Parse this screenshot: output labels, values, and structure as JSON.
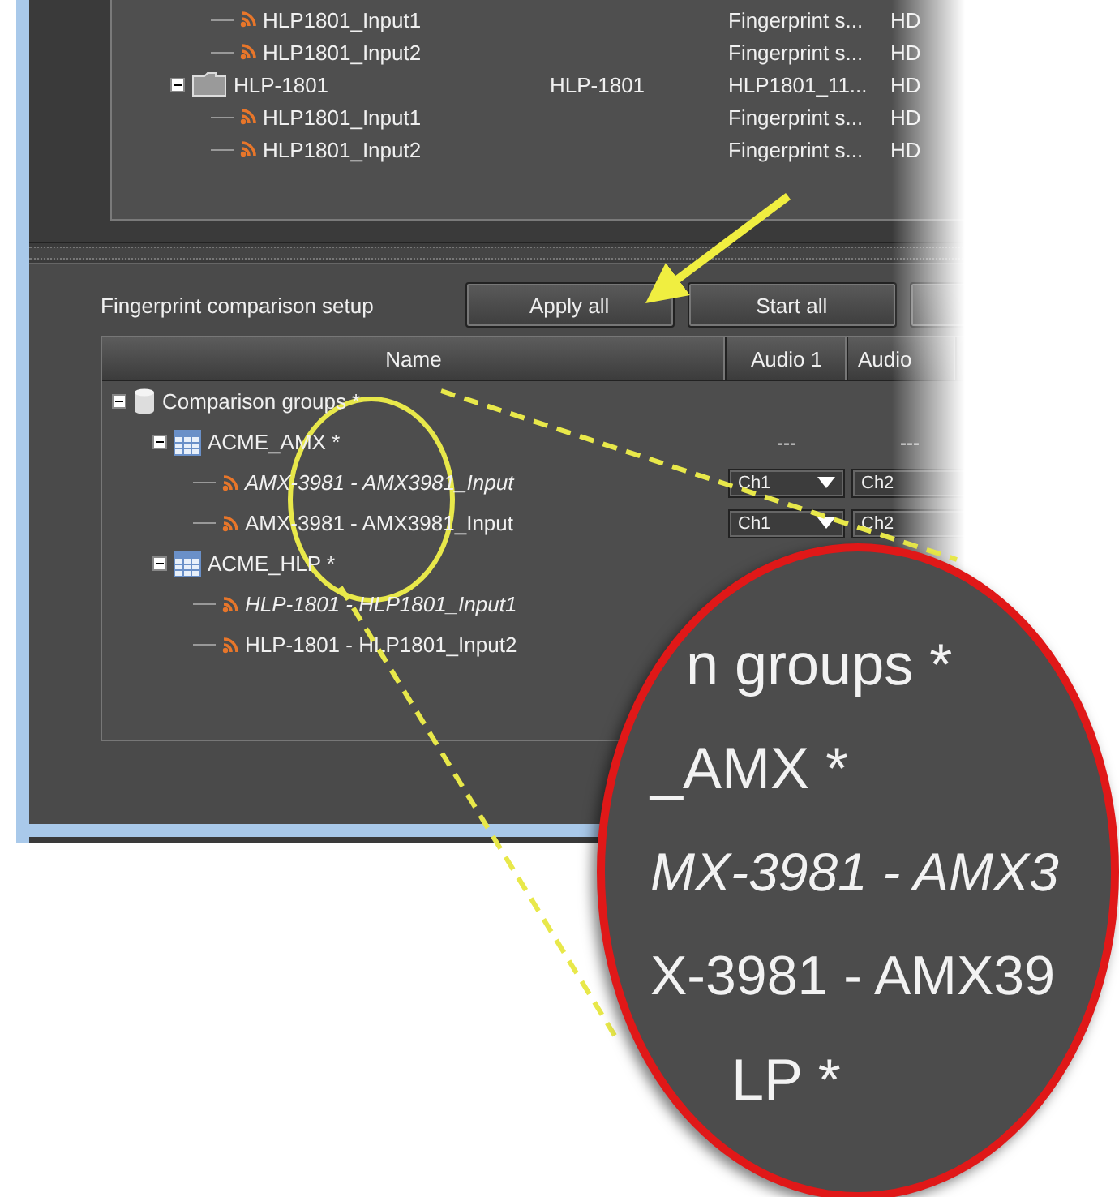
{
  "device_tree": {
    "continued": [
      {
        "kind": "input",
        "name": "HLP1801_Input1",
        "column_3": "Fingerprint s...",
        "column_4": "HD"
      },
      {
        "kind": "input",
        "name": "HLP1801_Input2",
        "column_3": "Fingerprint s...",
        "column_4": "HD"
      }
    ],
    "nodes": [
      {
        "kind": "folder",
        "name": "HLP-1801",
        "column_2": "HLP-1801",
        "column_3": "HLP1801_11...",
        "column_4": "HD",
        "expanded": true,
        "children": [
          {
            "kind": "input",
            "name": "HLP1801_Input1",
            "column_3": "Fingerprint s...",
            "column_4": "HD"
          },
          {
            "kind": "input",
            "name": "HLP1801_Input2",
            "column_3": "Fingerprint s...",
            "column_4": "HD"
          }
        ]
      }
    ]
  },
  "comparison": {
    "label": "Fingerprint comparison setup",
    "buttons": [
      "Apply all",
      "Start all"
    ],
    "partial_button": true,
    "columns": [
      "Name",
      "Audio 1",
      "Audio"
    ],
    "tree": [
      {
        "kind": "database",
        "name": "Comparison groups *",
        "expanded": true,
        "children": [
          {
            "kind": "group",
            "name": "ACME_AMX *",
            "expanded": true,
            "audio": [
              {
                "kind": "text",
                "value": "---"
              },
              {
                "kind": "text",
                "value": "---"
              }
            ],
            "children": [
              {
                "kind": "input",
                "name": "AMX-3981 - AMX3981_Input",
                "italic": true,
                "audio": [
                  {
                    "kind": "dropdown",
                    "value": "Ch1"
                  },
                  {
                    "kind": "field",
                    "value": "Ch2"
                  }
                ]
              },
              {
                "kind": "input",
                "name": "AMX-3981 - AMX3981_Input",
                "italic": false,
                "audio": [
                  {
                    "kind": "dropdown",
                    "value": "Ch1"
                  },
                  {
                    "kind": "field",
                    "value": "Ch2"
                  }
                ]
              }
            ]
          },
          {
            "kind": "group",
            "name": "ACME_HLP *",
            "expanded": true,
            "children": [
              {
                "kind": "input",
                "name": "HLP-1801 - HLP1801_Input1",
                "italic": true
              },
              {
                "kind": "input",
                "name": "HLP-1801 - HLP1801_Input2",
                "italic": false
              }
            ]
          }
        ]
      }
    ]
  },
  "magnifier": {
    "lines": [
      {
        "text": "n groups *",
        "italic": false
      },
      {
        "text": "_AMX *",
        "italic": false
      },
      {
        "text": "MX-3981 - AMX3",
        "italic": true
      },
      {
        "text": "X-3981 - AMX39",
        "italic": false
      },
      {
        "text": "LP *",
        "italic": false
      }
    ]
  }
}
